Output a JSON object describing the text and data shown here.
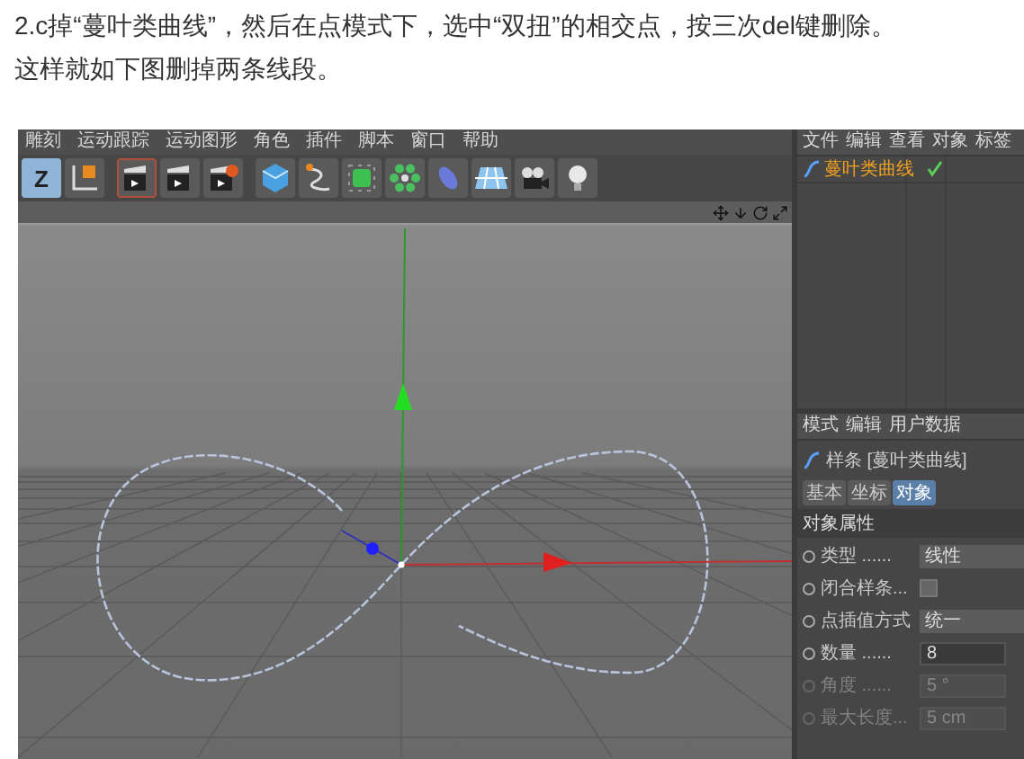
{
  "article": {
    "paragraphs": [
      "2.c掉“蔓叶类曲线”，然后在点模式下，选中“双扭”的相交点，按三次del键删除。",
      "这样就如下图删掉两条线段。"
    ]
  },
  "app": {
    "menu": [
      "雕刻",
      "运动跟踪",
      "运动图形",
      "角色",
      "插件",
      "脚本",
      "窗口",
      "帮助"
    ],
    "toolbar": [
      {
        "kind": "letter",
        "label": "Z"
      },
      {
        "kind": "axis"
      },
      {
        "kind": "clapper",
        "selected": true
      },
      {
        "kind": "clapper",
        "selected": false
      },
      {
        "kind": "clapper-gear",
        "selected": false
      },
      {
        "kind": "cube"
      },
      {
        "kind": "pen"
      },
      {
        "kind": "nurbs"
      },
      {
        "kind": "cloner"
      },
      {
        "kind": "deformer"
      },
      {
        "kind": "floor"
      },
      {
        "kind": "camera"
      },
      {
        "kind": "light"
      }
    ],
    "object_manager": {
      "menu": [
        "文件",
        "编辑",
        "查看",
        "对象",
        "标签"
      ],
      "objects": [
        {
          "name": "蔓叶类曲线",
          "selected": true,
          "enabled": true
        }
      ]
    },
    "attributes": {
      "menu": [
        "模式",
        "编辑",
        "用户数据"
      ],
      "title": "样条 [蔓叶类曲线]",
      "tabs": [
        {
          "label": "基本",
          "selected": false
        },
        {
          "label": "坐标",
          "selected": false
        },
        {
          "label": "对象",
          "selected": true
        }
      ],
      "section": "对象属性",
      "fields": [
        {
          "kind": "select",
          "label": "类型 ......",
          "value": "线性",
          "disabled": false
        },
        {
          "kind": "checkbox",
          "label": "闭合样条...",
          "checked": false,
          "disabled": false
        },
        {
          "kind": "select",
          "label": "点插值方式",
          "value": "统一",
          "disabled": false
        },
        {
          "kind": "number",
          "label": "数量 ......",
          "value": "8",
          "disabled": false
        },
        {
          "kind": "number",
          "label": "角度 ......",
          "value": "5 °",
          "disabled": true
        },
        {
          "kind": "number",
          "label": "最大长度...",
          "value": "5 cm",
          "disabled": true
        }
      ]
    }
  }
}
